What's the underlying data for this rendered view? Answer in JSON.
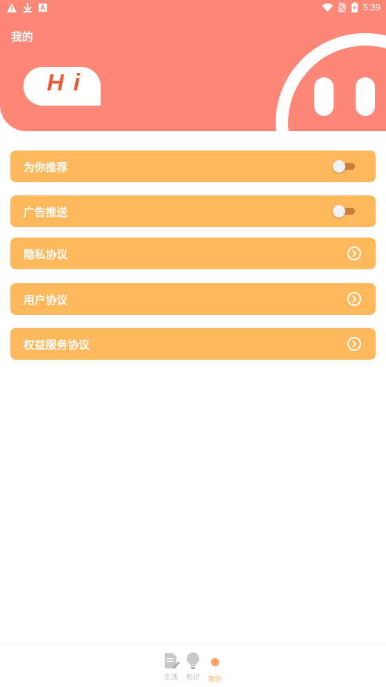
{
  "status_bar": {
    "time": "5:39",
    "left_icons": [
      "warning-icon",
      "download-icon",
      "font-icon"
    ],
    "right_icons": [
      "wifi-icon",
      "no-sim-icon",
      "battery-icon"
    ]
  },
  "header": {
    "title": "我的",
    "greeting": "Hi"
  },
  "colors": {
    "header_bg": "#fd8877",
    "menu_bg": "#ffb85c",
    "accent_text": "#e95a3a",
    "nav_active": "#f9b36a"
  },
  "menu": {
    "items": [
      {
        "label": "为你推荐",
        "control": "toggle",
        "on": false
      },
      {
        "label": "广告推送",
        "control": "toggle",
        "on": false
      },
      {
        "label": "隐私协议",
        "control": "chevron"
      },
      {
        "label": "用户协议",
        "control": "chevron"
      },
      {
        "label": "权益服务协议",
        "control": "chevron"
      }
    ]
  },
  "bottom_nav": {
    "items": [
      {
        "label": "生活",
        "icon": "document-edit-icon",
        "active": false
      },
      {
        "label": "知识",
        "icon": "lightbulb-icon",
        "active": false
      },
      {
        "label": "我的",
        "icon": "dot-icon",
        "active": true
      }
    ]
  }
}
